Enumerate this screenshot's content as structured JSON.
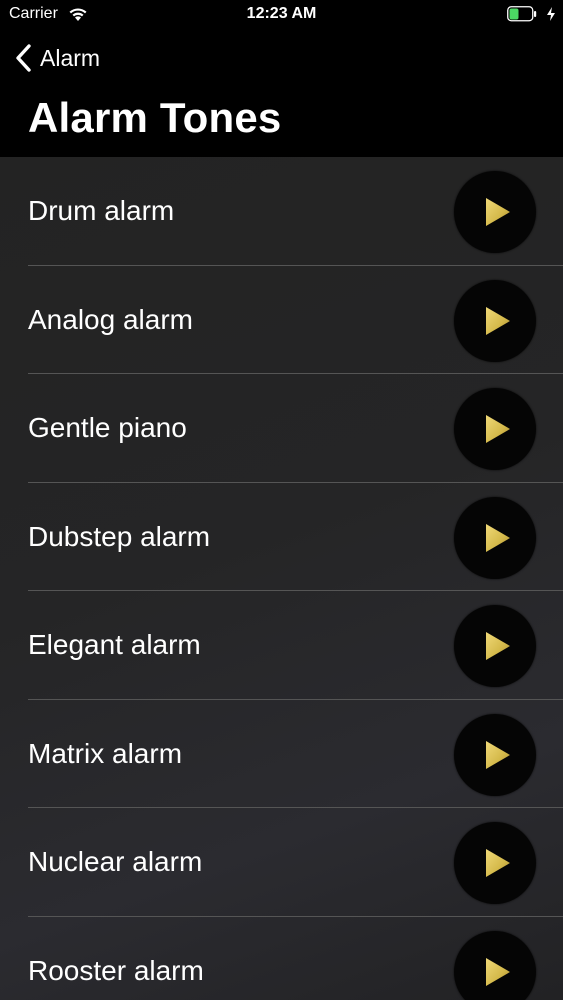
{
  "status_bar": {
    "carrier": "Carrier",
    "time": "12:23 AM",
    "battery_color": "#4cd964"
  },
  "nav": {
    "back_label": "Alarm",
    "title": "Alarm Tones"
  },
  "tones": [
    {
      "name": "Drum alarm"
    },
    {
      "name": "Analog alarm"
    },
    {
      "name": "Gentle piano"
    },
    {
      "name": "Dubstep alarm"
    },
    {
      "name": "Elegant alarm"
    },
    {
      "name": "Matrix alarm"
    },
    {
      "name": "Nuclear alarm"
    },
    {
      "name": "Rooster alarm"
    }
  ],
  "colors": {
    "play_icon": "#d4b94a",
    "list_background": "#252526",
    "divider": "#555555"
  },
  "icons": {
    "play": "play-icon",
    "back": "chevron-left-icon"
  }
}
